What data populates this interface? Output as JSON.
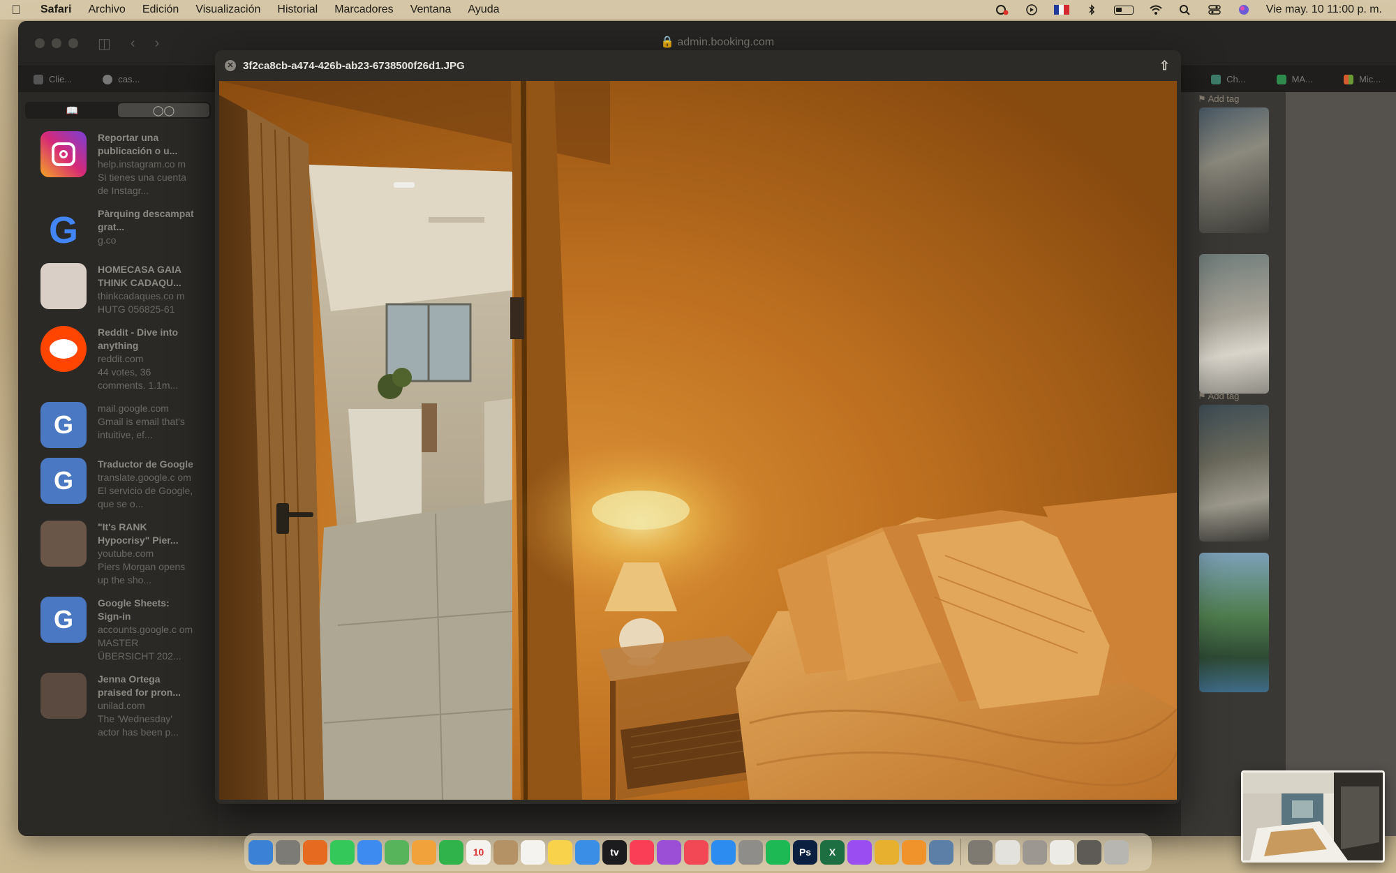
{
  "menubar": {
    "app_name": "Safari",
    "menus": [
      "Archivo",
      "Edición",
      "Visualización",
      "Historial",
      "Marcadores",
      "Ventana",
      "Ayuda"
    ],
    "clock": "Vie may. 10  11:00 p. m."
  },
  "browser": {
    "address": "admin.booking.com",
    "tabs_left": [
      "Clie...",
      "cas..."
    ],
    "tabs_right": [
      "Ch...",
      "MA...",
      "Mic..."
    ]
  },
  "sidebar": {
    "items": [
      {
        "title": "Reportar una publicación o u...",
        "domain": "help.instagram.co m",
        "desc": "Si tienes una cuenta de Instagr...",
        "icon": "instagram-icon",
        "color": "#c13584"
      },
      {
        "title": "Pàrquing descampat grat...",
        "domain": "g.co",
        "desc": "",
        "icon": "google-icon",
        "color": "#e2e0da"
      },
      {
        "title": "HOMECASA GAIA THINK CADAQU...",
        "domain": "thinkcadaques.co m",
        "desc": "HUTG 056825-61",
        "icon": "thinkcadaques-icon",
        "color": "#d9cfc6"
      },
      {
        "title": "Reddit - Dive into anything",
        "domain": "reddit.com",
        "desc": "44 votes, 36 comments. 1.1m...",
        "icon": "reddit-icon",
        "color": "#ff4500"
      },
      {
        "title": "",
        "domain": "mail.google.com",
        "desc": "Gmail is email that's intuitive, ef...",
        "icon": "gmail-letter-icon",
        "color": "#4a78c2",
        "letter": "G"
      },
      {
        "title": "Traductor de Google",
        "domain": "translate.google.c om",
        "desc": "El servicio de Google, que se o...",
        "icon": "google-translate-icon",
        "color": "#4a78c2",
        "letter": "G"
      },
      {
        "title": "\"It's RANK Hypocrisy\" Pier...",
        "domain": "youtube.com",
        "desc": "Piers Morgan opens up the sho...",
        "icon": "video-thumbnail-icon",
        "color": "#6a5648"
      },
      {
        "title": "Google Sheets: Sign-in",
        "domain": "accounts.google.c om",
        "desc": "MASTER ÜBERSICHT 202...",
        "icon": "google-sheets-letter-icon",
        "color": "#4a78c2",
        "letter": "G"
      },
      {
        "title": "Jenna Ortega praised for pron...",
        "domain": "unilad.com",
        "desc": "The 'Wednesday' actor has been p...",
        "icon": "news-thumbnail-icon",
        "color": "#5a4a40"
      }
    ]
  },
  "right_panel": {
    "tag_label_1": "Add tag",
    "tag_label_2": "Add tag"
  },
  "quicklook": {
    "filename": "3f2ca8cb-a474-426b-ab23-6738500f26d1.JPG"
  },
  "dock": {
    "icons": [
      {
        "name": "finder-icon",
        "color": "#3b82d6"
      },
      {
        "name": "launchpad-icon",
        "color": "#7d7b76"
      },
      {
        "name": "firefox-icon",
        "color": "#e66a1f"
      },
      {
        "name": "messages-icon",
        "color": "#34c759"
      },
      {
        "name": "mail-icon",
        "color": "#3d8bf0"
      },
      {
        "name": "maps-icon",
        "color": "#58b45b"
      },
      {
        "name": "photos-icon",
        "color": "#f2a23a"
      },
      {
        "name": "facetime-icon",
        "color": "#2fb34a"
      },
      {
        "name": "calendar-icon",
        "color": "#f5f3ef",
        "text": "10"
      },
      {
        "name": "contacts-icon",
        "color": "#b59266"
      },
      {
        "name": "reminders-icon",
        "color": "#f5f3ef"
      },
      {
        "name": "notes-icon",
        "color": "#f7d24a"
      },
      {
        "name": "safari-icon",
        "color": "#3a8ee6"
      },
      {
        "name": "appletv-icon",
        "color": "#1c1c1e",
        "text": "tv"
      },
      {
        "name": "music-icon",
        "color": "#fa3e55"
      },
      {
        "name": "podcasts-icon",
        "color": "#9b4fd6"
      },
      {
        "name": "news-icon",
        "color": "#f24755"
      },
      {
        "name": "appstore-icon",
        "color": "#2d8cf0"
      },
      {
        "name": "settings-icon",
        "color": "#8e8d89"
      },
      {
        "name": "spotify-icon",
        "color": "#1db954"
      },
      {
        "name": "photoshop-icon",
        "color": "#0b2040",
        "text": "Ps"
      },
      {
        "name": "excel-icon",
        "color": "#1d6f42",
        "text": "X"
      },
      {
        "name": "messenger-icon",
        "color": "#9a4df0"
      },
      {
        "name": "chrome-icon",
        "color": "#e7b12f"
      },
      {
        "name": "pages-icon",
        "color": "#f0932b"
      },
      {
        "name": "preview-icon",
        "color": "#5b7fa6"
      }
    ],
    "recent": [
      {
        "name": "stack-1-icon",
        "color": "#7e7a72"
      },
      {
        "name": "stack-2-icon",
        "color": "#e4e2dc"
      },
      {
        "name": "stack-3-icon",
        "color": "#9c9891"
      },
      {
        "name": "stack-4-icon",
        "color": "#ecebe6"
      },
      {
        "name": "stack-5-icon",
        "color": "#5e5b56"
      },
      {
        "name": "trash-icon",
        "color": "#b8b6b0"
      }
    ]
  }
}
